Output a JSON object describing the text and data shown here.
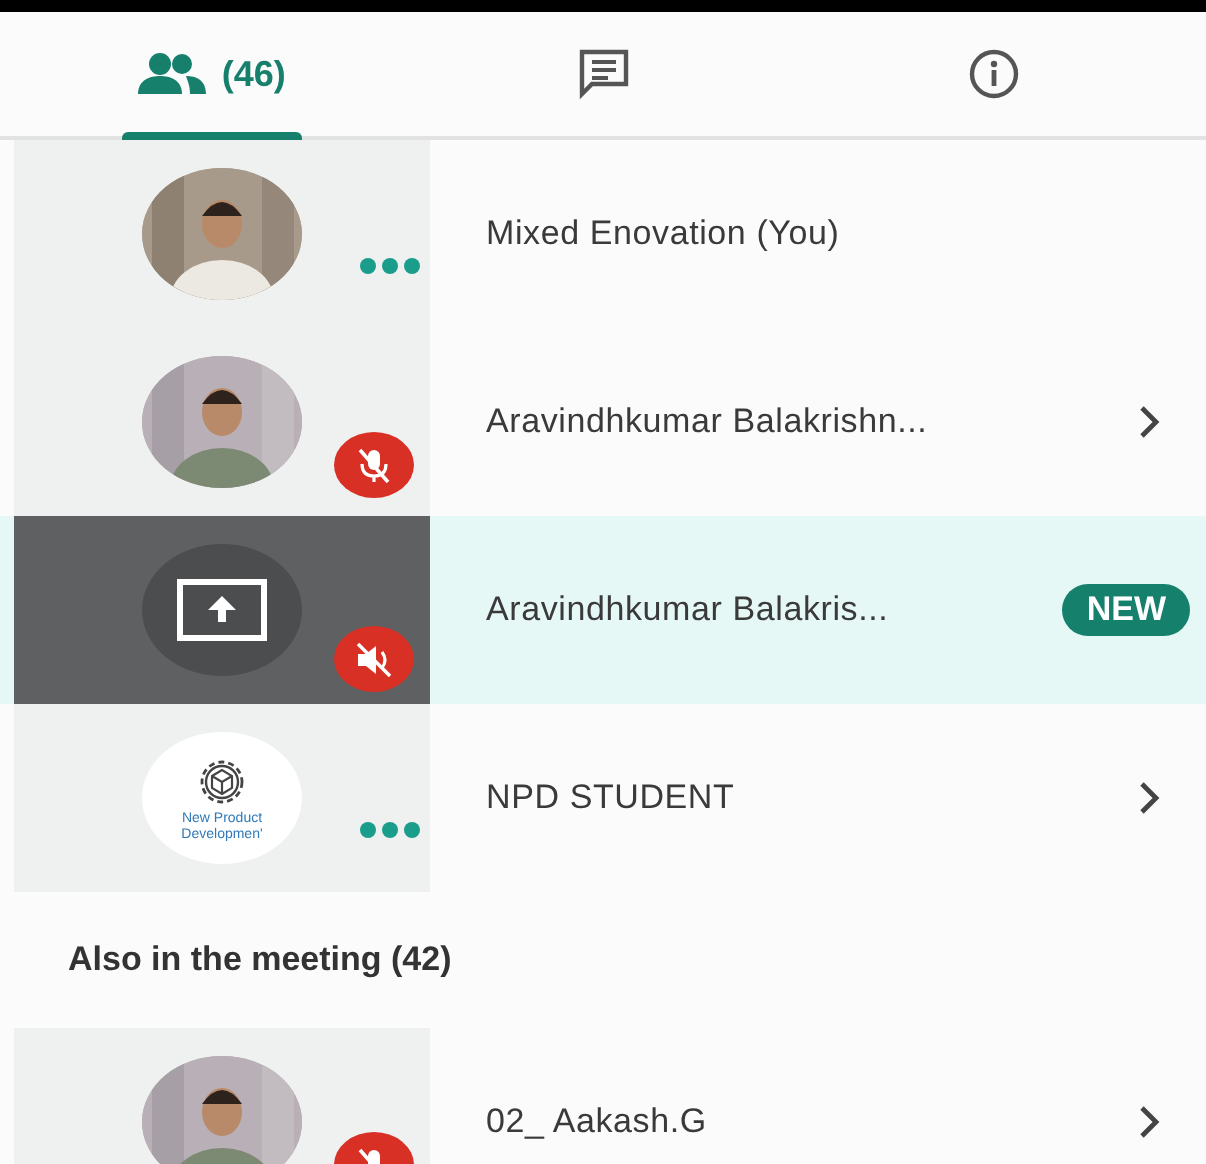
{
  "tabs": [
    {
      "kind": "people",
      "label": "(46)",
      "selected": true
    },
    {
      "kind": "chat",
      "selected": false
    },
    {
      "kind": "info",
      "selected": false
    }
  ],
  "participants": [
    {
      "name": "Mixed Enovation (You)",
      "status": {
        "kind": "speaking"
      },
      "chevron": false,
      "selected": false
    },
    {
      "name": "Aravindhkumar Balakrishn...",
      "status": {
        "kind": "mic_muted"
      },
      "chevron": true,
      "selected": false
    },
    {
      "name": "Aravindhkumar Balakris...",
      "kind": "presenting",
      "status": {
        "kind": "audio_muted"
      },
      "chevron": false,
      "badge": "NEW",
      "selected": true
    },
    {
      "name": "NPD STUDENT",
      "kind": "logo",
      "logo_lines": [
        "New Product",
        "Developmen'"
      ],
      "status": {
        "kind": "speaking"
      },
      "chevron": true,
      "selected": false
    }
  ],
  "section": {
    "title": "Also in the meeting (42)",
    "participants": [
      {
        "name": "02_ Aakash.G",
        "status": {
          "kind": "mic_muted"
        },
        "chevron": true,
        "selected": false
      }
    ]
  }
}
